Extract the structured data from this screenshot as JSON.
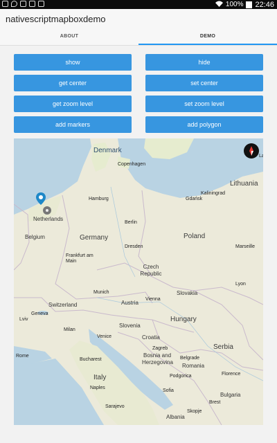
{
  "status_bar": {
    "battery": "100%",
    "time": "22:46",
    "icons": [
      "android-icon",
      "location-icon",
      "image-icon",
      "briefcase-icon",
      "photo-icon",
      "wifi-icon",
      "battery-icon"
    ]
  },
  "app": {
    "title": "nativescriptmapboxdemo"
  },
  "tabs": [
    {
      "label": "ABOUT",
      "selected": false
    },
    {
      "label": "DEMO",
      "selected": true
    }
  ],
  "buttons": {
    "show": "show",
    "hide": "hide",
    "get_center": "get center",
    "set_center": "set center",
    "get_zoom": "get zoom level",
    "set_zoom": "set zoom level",
    "add_markers": "add markers",
    "add_polygon": "add polygon"
  },
  "map": {
    "seas": [
      "Denmark"
    ],
    "countries": [
      "Netherlands",
      "Germany",
      "Poland",
      "Belgium",
      "Czech Republic",
      "Switzerland",
      "Austria",
      "Slovakia",
      "Hungary",
      "Slovenia",
      "Croatia",
      "Bosnia and Herzegovina",
      "Serbia",
      "Romania",
      "Italy",
      "Bulgaria",
      "Albania",
      "Lithuania"
    ],
    "cities": [
      "Copenhagen",
      "Hamburg",
      "Gdańsk",
      "Kaliningrad",
      "Berlin",
      "Dresden",
      "Frankfurt am Main",
      "Munich",
      "Vienna",
      "Geneva",
      "Milan",
      "Venice",
      "Zagreb",
      "Belgrade",
      "Bucharest",
      "Florence",
      "Rome",
      "Naples",
      "Marseille",
      "Lyon",
      "Sarajevo",
      "Podgorica",
      "Sofia",
      "Brest",
      "Lviv",
      "Skopje"
    ],
    "partial_labels": [
      "La"
    ],
    "accent_color": "#2196f3",
    "button_color": "#3796e0"
  }
}
